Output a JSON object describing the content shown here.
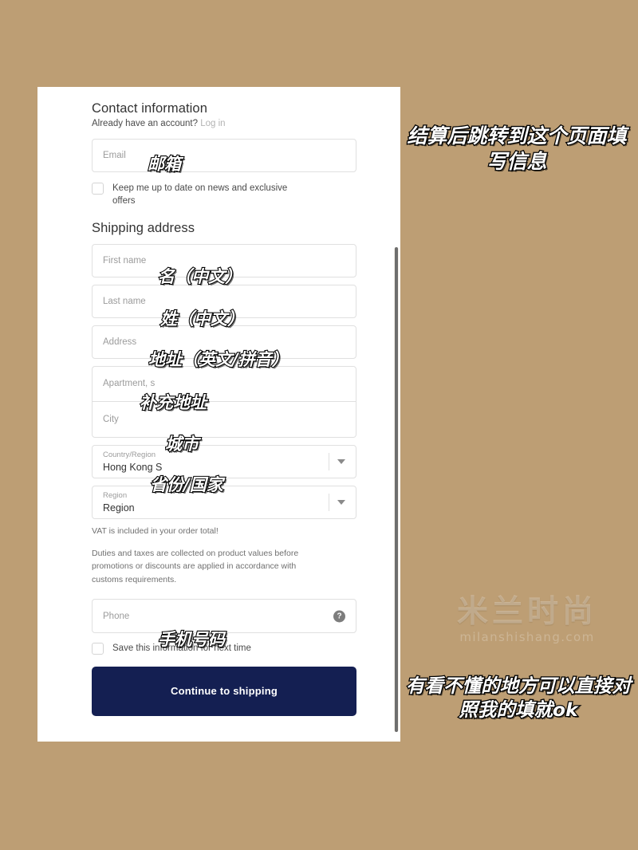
{
  "page": {
    "background_color": "#bd9e74",
    "card_background": "#ffffff"
  },
  "checkout": {
    "contact": {
      "title": "Contact information",
      "login_prompt": "Already have an account?",
      "login_link": "Log in",
      "email_placeholder": "Email",
      "newsletter_label": "Keep me up to date on news and exclusive offers"
    },
    "shipping": {
      "title": "Shipping address",
      "first_name_placeholder": "First name",
      "last_name_placeholder": "Last name",
      "address_placeholder": "Address",
      "apartment_placeholder": "Apartment, s",
      "city_placeholder": "City",
      "country_label": "Country/Region",
      "country_value": "Hong Kong S",
      "region_label": "Region",
      "region_value": "Region",
      "vat_note": "VAT is included in your order total!",
      "duties_note": "Duties and taxes are collected on product values before promotions or discounts are applied in accordance with customs requirements.",
      "phone_placeholder": "Phone",
      "phone_help_icon": "help-circle-icon",
      "save_info_label": "Save this information for next time"
    },
    "continue_button": "Continue to shipping",
    "button_color": "#141f52"
  },
  "annotations": {
    "top_note": "结算后跳转到这个页面填写信息",
    "bottom_note": "有看不懂的地方可以直接对照我的填就ok",
    "email": "邮箱",
    "first_name": "名（中文）",
    "last_name": "姓（中文）",
    "address": "地址（英文/拼音）",
    "apartment": "补充地址",
    "city": "城市",
    "country": "省份/国家",
    "phone": "手机号码"
  },
  "watermark": {
    "main": "米兰时尚",
    "sub": "milanshishang.com"
  }
}
